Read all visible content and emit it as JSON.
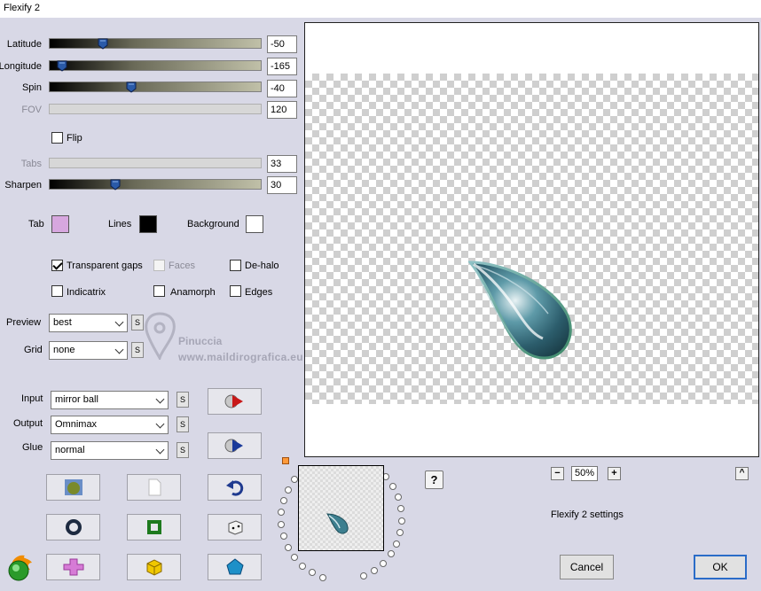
{
  "window": {
    "title": "Flexify 2"
  },
  "sliders": [
    {
      "label": "Latitude",
      "value": "-50",
      "level": 0.24,
      "enabled": true
    },
    {
      "label": "Longitude",
      "value": "-165",
      "level": 0.04,
      "enabled": true
    },
    {
      "label": "Spin",
      "value": "-40",
      "level": 0.38,
      "enabled": true
    },
    {
      "label": "FOV",
      "value": "120",
      "level": 0,
      "enabled": false
    },
    {
      "label": "Tabs",
      "value": "33",
      "level": 0,
      "enabled": false
    },
    {
      "label": "Sharpen",
      "value": "30",
      "level": 0.3,
      "enabled": true
    }
  ],
  "flip": {
    "label": "Flip",
    "checked": false
  },
  "colors": {
    "tab_label": "Tab",
    "tab_color": "#d7a7df",
    "lines_label": "Lines",
    "lines_color": "#000000",
    "background_label": "Background",
    "background_color": "#ffffff"
  },
  "options": {
    "transparent_gaps": {
      "label": "Transparent gaps",
      "checked": true
    },
    "faces": {
      "label": "Faces",
      "checked": false
    },
    "dehalo": {
      "label": "De-halo",
      "checked": false
    },
    "indicatrix": {
      "label": "Indicatrix",
      "checked": false
    },
    "anamorph": {
      "label": "Anamorph",
      "checked": false
    },
    "edges": {
      "label": "Edges",
      "checked": false
    }
  },
  "preview_select": {
    "label": "Preview",
    "value": "best",
    "s": "S"
  },
  "grid_select": {
    "label": "Grid",
    "value": "none",
    "s": "S"
  },
  "input_select": {
    "label": "Input",
    "value": "mirror ball",
    "s": "S"
  },
  "output_select": {
    "label": "Output",
    "value": "Omnimax",
    "s": "S"
  },
  "glue_select": {
    "label": "Glue",
    "value": "normal",
    "s": "S"
  },
  "watermark": {
    "name": "Pinuccia",
    "url": "www.maildirografica.eu"
  },
  "zoom": {
    "minus": "−",
    "value": "50%",
    "plus": "+"
  },
  "help": "?",
  "collapse": "^",
  "settings_label": "Flexify 2 settings",
  "buttons": {
    "cancel": "Cancel",
    "ok": "OK"
  }
}
